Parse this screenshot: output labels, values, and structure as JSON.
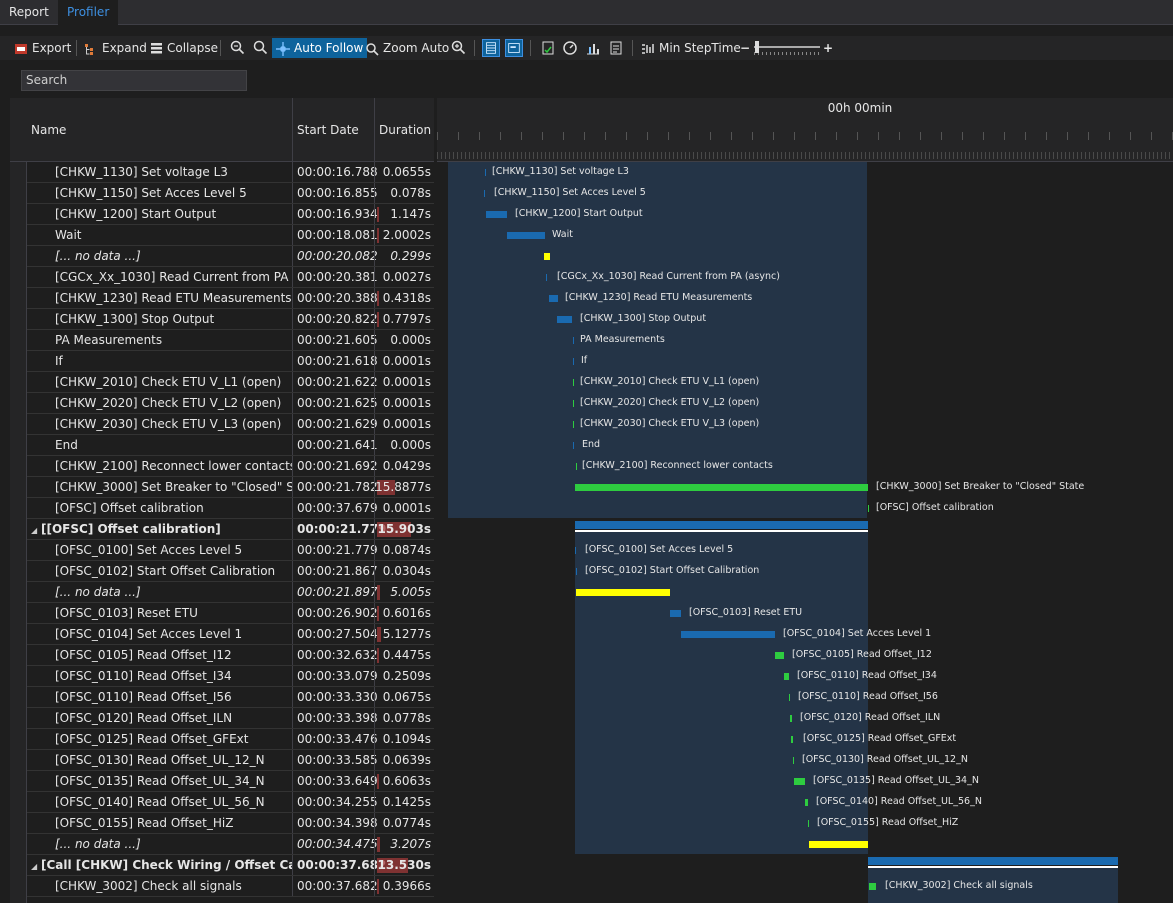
{
  "tabs": [
    {
      "label": "Report"
    },
    {
      "label": "Profiler"
    }
  ],
  "toolbar": {
    "export": "Export",
    "expand": "Expand",
    "collapse": "Collapse",
    "auto_follow": "Auto Follow",
    "zoom_auto": "Zoom Auto",
    "min_steptime": "Min StepTime",
    "minus": "−",
    "plus": "+"
  },
  "search": {
    "placeholder": "Search"
  },
  "columns": {
    "name": "Name",
    "start": "Start Date",
    "duration": "Duration"
  },
  "timeline_header": "00h 00min",
  "rows": [
    {
      "name": "[CHKW_1130] Set voltage L3",
      "start": "00:00:16.788",
      "duration": "0.0655s",
      "fill": 0.0
    },
    {
      "name": "[CHKW_1150] Set Acces Level 5",
      "start": "00:00:16.855",
      "duration": "0.078s",
      "fill": 0.0
    },
    {
      "name": "[CHKW_1200] Start Output",
      "start": "00:00:16.934",
      "duration": "1.147s",
      "fill": 0.02
    },
    {
      "name": "Wait",
      "start": "00:00:18.081",
      "duration": "2.0002s",
      "fill": 0.03
    },
    {
      "name": "[... no data ...]",
      "start": "00:00:20.082",
      "duration": "0.299s",
      "fill": 0.0
    },
    {
      "name": "[CGCx_Xx_1030] Read Current from PA (as...",
      "start": "00:00:20.381",
      "duration": "0.0027s",
      "fill": 0.0
    },
    {
      "name": "[CHKW_1230] Read ETU Measurements",
      "start": "00:00:20.388",
      "duration": "0.4318s",
      "fill": 0.01
    },
    {
      "name": "[CHKW_1300] Stop Output",
      "start": "00:00:20.822",
      "duration": "0.7797s",
      "fill": 0.01
    },
    {
      "name": "PA Measurements",
      "start": "00:00:21.605",
      "duration": "0.000s",
      "fill": 0.0
    },
    {
      "name": "If",
      "start": "00:00:21.618",
      "duration": "0.0001s",
      "fill": 0.0
    },
    {
      "name": "[CHKW_2010] Check ETU V_L1 (open)",
      "start": "00:00:21.622",
      "duration": "0.0001s",
      "fill": 0.0
    },
    {
      "name": "[CHKW_2020] Check ETU V_L2 (open)",
      "start": "00:00:21.625",
      "duration": "0.0001s",
      "fill": 0.0
    },
    {
      "name": "[CHKW_2030] Check ETU V_L3 (open)",
      "start": "00:00:21.629",
      "duration": "0.0001s",
      "fill": 0.0
    },
    {
      "name": "End",
      "start": "00:00:21.641",
      "duration": "0.000s",
      "fill": 0.0
    },
    {
      "name": "[CHKW_2100] Reconnect lower contacts",
      "start": "00:00:21.692",
      "duration": "0.0429s",
      "fill": 0.0
    },
    {
      "name": "[CHKW_3000] Set Breaker to \"Closed\" State",
      "start": "00:00:21.782",
      "duration": "15.8877s",
      "fill": 0.33
    },
    {
      "name": "[OFSC] Offset calibration",
      "start": "00:00:37.679",
      "duration": "0.0001s",
      "fill": 0.0
    },
    {
      "name": "[[OFSC] Offset calibration]",
      "start": "00:00:21.779",
      "duration": "15.903s",
      "fill": 0.6
    },
    {
      "name": "[OFSC_0100] Set Acces Level 5",
      "start": "00:00:21.779",
      "duration": "0.0874s",
      "fill": 0.0
    },
    {
      "name": "[OFSC_0102] Start Offset Calibration",
      "start": "00:00:21.867",
      "duration": "0.0304s",
      "fill": 0.0
    },
    {
      "name": "[... no data ...]",
      "start": "00:00:21.897",
      "duration": "5.005s",
      "fill": 0.06
    },
    {
      "name": "[OFSC_0103] Reset ETU",
      "start": "00:00:26.902",
      "duration": "0.6016s",
      "fill": 0.01
    },
    {
      "name": "[OFSC_0104] Set Acces Level 1",
      "start": "00:00:27.504",
      "duration": "5.1277s",
      "fill": 0.07
    },
    {
      "name": "[OFSC_0105] Read Offset_I12",
      "start": "00:00:32.632",
      "duration": "0.4475s",
      "fill": 0.01
    },
    {
      "name": "[OFSC_0110] Read Offset_I34",
      "start": "00:00:33.079",
      "duration": "0.2509s",
      "fill": 0.0
    },
    {
      "name": "[OFSC_0110] Read Offset_I56",
      "start": "00:00:33.330",
      "duration": "0.0675s",
      "fill": 0.0
    },
    {
      "name": "[OFSC_0120] Read Offset_ILN",
      "start": "00:00:33.398",
      "duration": "0.0778s",
      "fill": 0.0
    },
    {
      "name": "[OFSC_0125] Read Offset_GFExt",
      "start": "00:00:33.476",
      "duration": "0.1094s",
      "fill": 0.0
    },
    {
      "name": "[OFSC_0130] Read Offset_UL_12_N",
      "start": "00:00:33.585",
      "duration": "0.0639s",
      "fill": 0.0
    },
    {
      "name": "[OFSC_0135] Read Offset_UL_34_N",
      "start": "00:00:33.649",
      "duration": "0.6063s",
      "fill": 0.01
    },
    {
      "name": "[OFSC_0140] Read Offset_UL_56_N",
      "start": "00:00:34.255",
      "duration": "0.1425s",
      "fill": 0.0
    },
    {
      "name": "[OFSC_0155] Read Offset_HiZ",
      "start": "00:00:34.398",
      "duration": "0.0774s",
      "fill": 0.0
    },
    {
      "name": "[... no data ...]",
      "start": "00:00:34.475",
      "duration": "3.207s",
      "fill": 0.05
    },
    {
      "name": "[Call [CHKW] Check Wiring / Offset Calib...",
      "start": "00:00:37.682",
      "duration": "13.530s",
      "fill": 0.55
    },
    {
      "name": "[CHKW_3002] Check all signals",
      "start": "00:00:37.682",
      "duration": "0.3966s",
      "fill": 0.01
    }
  ],
  "timeline_labels": [
    "[CHKW_1130] Set voltage L3",
    "[CHKW_1150] Set Acces Level 5",
    "[CHKW_1200] Start Output",
    "Wait",
    "",
    "[CGCx_Xx_1030] Read Current from PA (async)",
    "[CHKW_1230] Read ETU Measurements",
    "[CHKW_1300] Stop Output",
    "PA Measurements",
    "If",
    "[CHKW_2010] Check ETU V_L1 (open)",
    "[CHKW_2020] Check ETU V_L2 (open)",
    "[CHKW_2030] Check ETU V_L3 (open)",
    "End",
    "[CHKW_2100] Reconnect lower contacts",
    "[CHKW_3000] Set Breaker to \"Closed\" State",
    "[OFSC] Offset calibration",
    "",
    "[OFSC_0100] Set Acces Level 5",
    "[OFSC_0102] Start Offset Calibration",
    "",
    "[OFSC_0103] Reset ETU",
    "[OFSC_0104] Set Acces Level 1",
    "[OFSC_0105] Read Offset_I12",
    "[OFSC_0110] Read Offset_I34",
    "[OFSC_0110] Read Offset_I56",
    "[OFSC_0120] Read Offset_ILN",
    "[OFSC_0125] Read Offset_GFExt",
    "[OFSC_0130] Read Offset_UL_12_N",
    "[OFSC_0135] Read Offset_UL_34_N",
    "[OFSC_0140] Read Offset_UL_56_N",
    "[OFSC_0155] Read Offset_HiZ",
    "",
    "",
    "[CHKW_3002] Check all signals"
  ],
  "colors": {
    "accent": "#3d8fe0",
    "bar_blue": "#1a6ab0",
    "bar_green": "#2ecc40",
    "bar_yellow": "#ffff00",
    "duration_fill": "#a03a3a"
  }
}
